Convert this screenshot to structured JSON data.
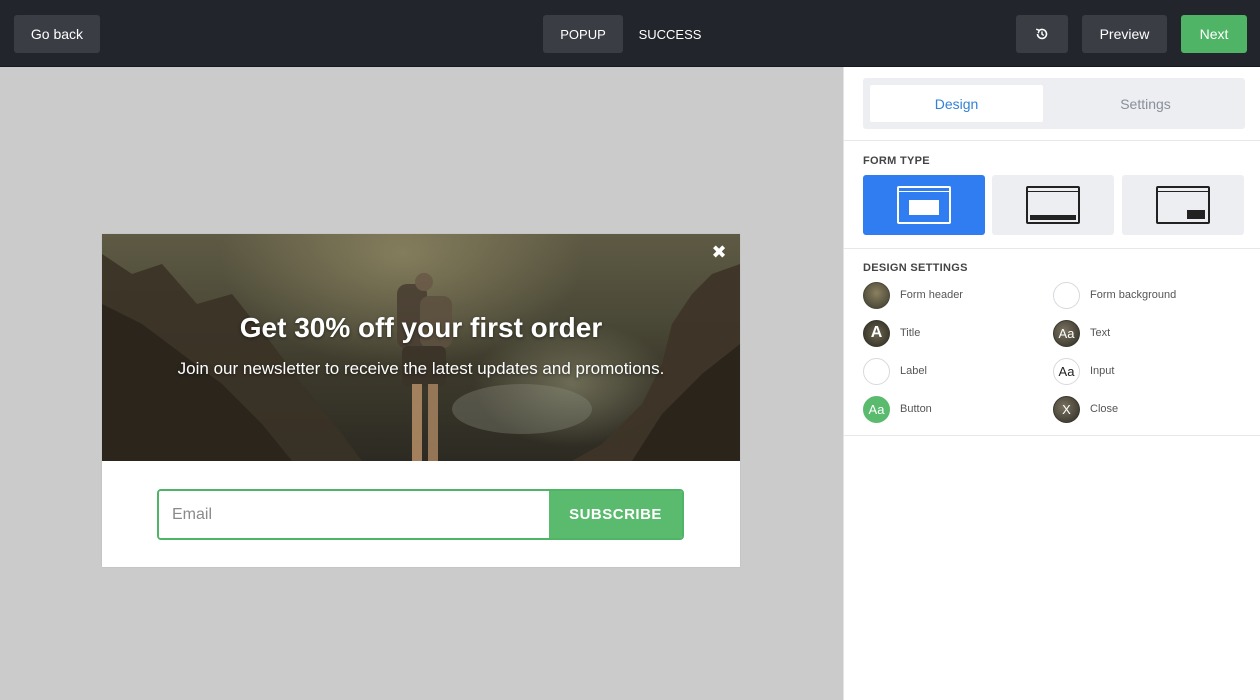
{
  "topbar": {
    "back_label": "Go back",
    "tabs": [
      {
        "label": "POPUP",
        "active": true
      },
      {
        "label": "SUCCESS",
        "active": false
      }
    ],
    "history_icon": "history-icon",
    "preview_label": "Preview",
    "next_label": "Next"
  },
  "popup": {
    "title": "Get 30% off your first order",
    "subtitle": "Join our newsletter to receive the latest updates and promotions.",
    "close_icon": "✖",
    "email_placeholder": "Email",
    "subscribe_label": "SUBSCRIBE"
  },
  "panel": {
    "tabs": [
      {
        "label": "Design",
        "active": true
      },
      {
        "label": "Settings",
        "active": false
      }
    ],
    "form_type_heading": "FORM TYPE",
    "form_types": [
      "popup-form-icon",
      "bar-form-icon",
      "slide-in-form-icon"
    ],
    "design_settings_heading": "DESIGN SETTINGS",
    "design_settings": [
      {
        "label": "Form header",
        "swatch": ""
      },
      {
        "label": "Form background",
        "swatch": ""
      },
      {
        "label": "Title",
        "swatch": "A"
      },
      {
        "label": "Text",
        "swatch": "Aa"
      },
      {
        "label": "Label",
        "swatch": ""
      },
      {
        "label": "Input",
        "swatch": "Aa"
      },
      {
        "label": "Button",
        "swatch": "Aa"
      },
      {
        "label": "Close",
        "swatch": "X"
      }
    ]
  },
  "colors": {
    "accent_green": "#4fb466",
    "accent_blue": "#2f7df1",
    "topbar_bg": "#22252b"
  }
}
